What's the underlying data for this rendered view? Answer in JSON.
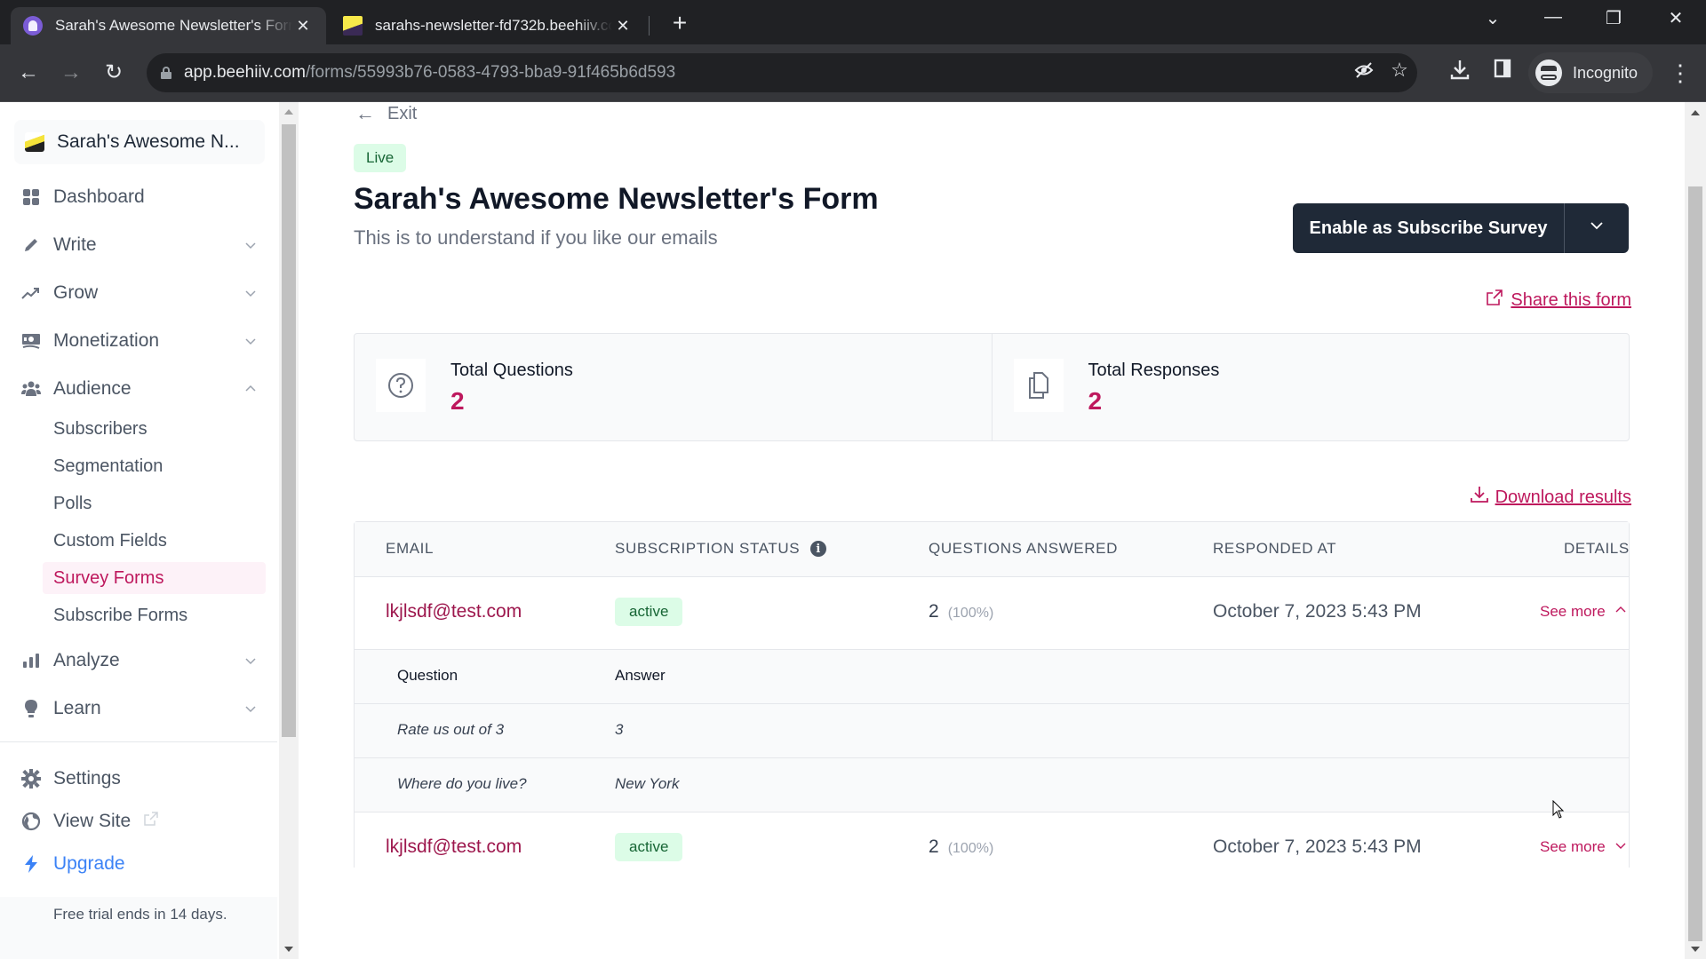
{
  "browser": {
    "tabs": [
      {
        "title": "Sarah's Awesome Newsletter's Form",
        "active": true
      },
      {
        "title": "sarahs-newsletter-fd732b.beehiiv.com",
        "active": false
      }
    ],
    "url_host": "app.beehiiv.com",
    "url_path": "/forms/55993b76-0583-4793-bba9-91f465b6d593",
    "profile_label": "Incognito"
  },
  "sidebar": {
    "publication": "Sarah's Awesome N...",
    "nav": [
      {
        "label": "Dashboard",
        "icon": "dashboard-icon",
        "expandable": false
      },
      {
        "label": "Write",
        "icon": "pencil-icon",
        "expandable": true,
        "expanded": false
      },
      {
        "label": "Grow",
        "icon": "trend-up-icon",
        "expandable": true,
        "expanded": false
      },
      {
        "label": "Monetization",
        "icon": "money-icon",
        "expandable": true,
        "expanded": false
      },
      {
        "label": "Audience",
        "icon": "users-icon",
        "expandable": true,
        "expanded": true
      },
      {
        "label": "Analyze",
        "icon": "bar-chart-icon",
        "expandable": true,
        "expanded": false
      },
      {
        "label": "Learn",
        "icon": "lightbulb-icon",
        "expandable": true,
        "expanded": false
      }
    ],
    "audience_sub": [
      {
        "label": "Subscribers",
        "active": false
      },
      {
        "label": "Segmentation",
        "active": false
      },
      {
        "label": "Polls",
        "active": false
      },
      {
        "label": "Custom Fields",
        "active": false
      },
      {
        "label": "Survey Forms",
        "active": true
      },
      {
        "label": "Subscribe Forms",
        "active": false
      }
    ],
    "bottom": [
      {
        "label": "Settings",
        "icon": "gear-icon"
      },
      {
        "label": "View Site",
        "icon": "globe-icon"
      },
      {
        "label": "Upgrade",
        "icon": "lightning-icon"
      }
    ],
    "trial_text": "Free trial ends in 14 days."
  },
  "main": {
    "exit_label": "Exit",
    "status_badge": "Live",
    "title": "Sarah's Awesome Newsletter's Form",
    "description": "This is to understand if you like our emails",
    "enable_button": "Enable as Subscribe Survey",
    "share_link": "Share this form",
    "stats": [
      {
        "label": "Total Questions",
        "value": "2",
        "icon": "question-circle-icon"
      },
      {
        "label": "Total Responses",
        "value": "2",
        "icon": "documents-icon"
      }
    ],
    "download_link": "Download results",
    "table": {
      "columns": [
        "EMAIL",
        "SUBSCRIPTION STATUS",
        "QUESTIONS ANSWERED",
        "RESPONDED AT",
        "DETAILS"
      ],
      "rows": [
        {
          "email": "lkjlsdf@test.com",
          "status": "active",
          "answered": "2",
          "answered_pct": "(100%)",
          "responded_at": "October 7, 2023 5:43 PM",
          "details_label": "See more",
          "expanded": true,
          "answers_header": {
            "question": "Question",
            "answer": "Answer"
          },
          "answers": [
            {
              "question": "Rate us out of 3",
              "answer": "3"
            },
            {
              "question": "Where do you live?",
              "answer": "New York"
            }
          ]
        },
        {
          "email": "lkjlsdf@test.com",
          "status": "active",
          "answered": "2",
          "answered_pct": "(100%)",
          "responded_at": "October 7, 2023 5:43 PM",
          "details_label": "See more",
          "expanded": false
        }
      ]
    }
  },
  "colors": {
    "accent": "#be185d",
    "button_dark": "#1f2937",
    "badge_bg": "#dcfce7",
    "badge_text": "#166534",
    "upgrade": "#3b82f6"
  }
}
